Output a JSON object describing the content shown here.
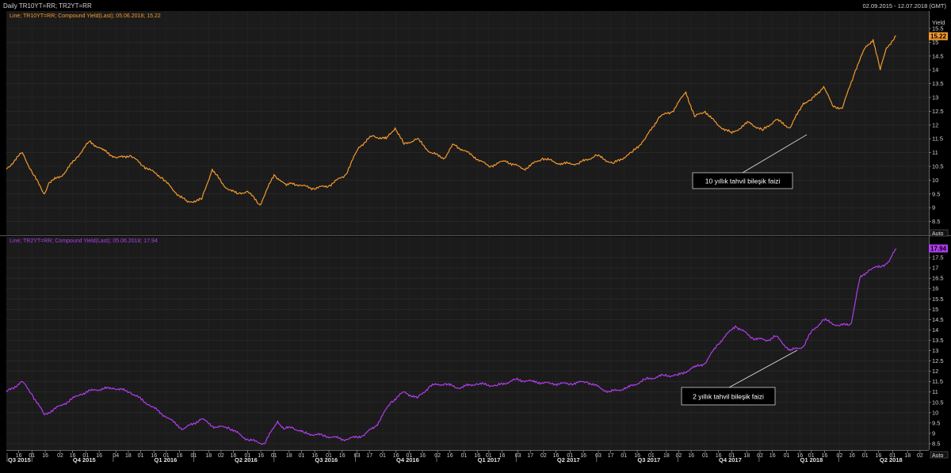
{
  "header": {
    "title": "Daily TR10YT=RR; TR2YT=RR",
    "date_range": "02.09.2015 - 12.07.2018 (GMT)"
  },
  "panels": {
    "top": {
      "legend": "Line; TR10YT=RR; Compound Yield(Last); 05.06.2018; 15.22",
      "axis_title": "Yield",
      "auto_label": "Auto",
      "last_value_label": "15.22",
      "annotation": "10 yıllık tahvil bileşik faizi"
    },
    "bottom": {
      "legend": "Line; TR2YT=RR; Compound Yield(Last); 05.06.2018; 17.94",
      "auto_label": "Auto",
      "last_value_label": "17.94",
      "annotation": "2 yıllık tahvil bileşik faizi"
    }
  },
  "colors": {
    "background": "#000000",
    "panel": "#1a1a1a",
    "grid": "#2c2c2c",
    "text": "#c8c8c8",
    "series_10y": "#f2992e",
    "series_2y": "#b23cf0"
  },
  "chart_data": [
    {
      "type": "line",
      "series": [
        {
          "name": "TR10YT=RR",
          "x": [
            "2015-09-02",
            "2015-09-20",
            "2015-10-01",
            "2015-10-15",
            "2015-10-20",
            "2015-11-05",
            "2015-11-20",
            "2015-12-05",
            "2015-12-20",
            "2016-01-05",
            "2016-01-20",
            "2016-02-05",
            "2016-02-25",
            "2016-03-10",
            "2016-03-25",
            "2016-04-10",
            "2016-04-22",
            "2016-05-05",
            "2016-05-20",
            "2016-06-01",
            "2016-06-15",
            "2016-07-01",
            "2016-07-08",
            "2016-07-15",
            "2016-07-21",
            "2016-08-01",
            "2016-08-15",
            "2016-09-01",
            "2016-09-20",
            "2016-10-05",
            "2016-10-20",
            "2016-11-05",
            "2016-11-15",
            "2016-11-25",
            "2016-12-10",
            "2016-12-25",
            "2017-01-10",
            "2017-01-20",
            "2017-02-10",
            "2017-03-01",
            "2017-03-20",
            "2017-04-10",
            "2017-05-01",
            "2017-05-20",
            "2017-06-10",
            "2017-07-01",
            "2017-07-20",
            "2017-08-10",
            "2017-08-25",
            "2017-09-10",
            "2017-09-25",
            "2017-10-10",
            "2017-10-20",
            "2017-11-01",
            "2017-11-15",
            "2017-12-01",
            "2017-12-20",
            "2018-01-05",
            "2018-01-20",
            "2018-02-05",
            "2018-02-20",
            "2018-03-01",
            "2018-03-15",
            "2018-03-25",
            "2018-04-05",
            "2018-04-20",
            "2018-05-01",
            "2018-05-10",
            "2018-05-18",
            "2018-05-25",
            "2018-06-05"
          ],
          "values": [
            10.4,
            11.0,
            10.3,
            9.5,
            9.9,
            10.2,
            10.8,
            11.4,
            11.1,
            10.8,
            10.9,
            10.5,
            10.1,
            9.6,
            9.2,
            9.3,
            10.4,
            9.8,
            9.5,
            9.6,
            9.1,
            10.2,
            10.0,
            9.8,
            9.9,
            9.8,
            9.7,
            9.8,
            10.2,
            11.2,
            11.6,
            11.5,
            11.9,
            11.3,
            11.5,
            11.0,
            10.8,
            11.3,
            10.9,
            10.5,
            10.7,
            10.4,
            10.8,
            10.6,
            10.6,
            10.9,
            10.6,
            11.0,
            11.5,
            12.3,
            12.5,
            13.2,
            12.3,
            12.5,
            12.0,
            11.7,
            12.1,
            11.8,
            12.2,
            11.9,
            12.8,
            12.9,
            13.4,
            12.7,
            12.6,
            14.0,
            14.8,
            15.1,
            14.0,
            14.8,
            15.22
          ]
        }
      ],
      "ylim": [
        8,
        15.5
      ],
      "ylabel": "Yield",
      "yticks": [
        8.5,
        9,
        9.5,
        10,
        10.5,
        11,
        11.5,
        12,
        12.5,
        13,
        13.5,
        14,
        14.5,
        15,
        15.5
      ],
      "title": "",
      "xlabel": "",
      "grid": true
    },
    {
      "type": "line",
      "series": [
        {
          "name": "TR2YT=RR",
          "x": [
            "2015-09-02",
            "2015-09-20",
            "2015-10-01",
            "2015-10-15",
            "2015-11-05",
            "2015-11-25",
            "2015-12-10",
            "2016-01-01",
            "2016-01-20",
            "2016-02-10",
            "2016-03-01",
            "2016-03-20",
            "2016-04-10",
            "2016-04-25",
            "2016-05-10",
            "2016-06-01",
            "2016-06-20",
            "2016-07-05",
            "2016-07-12",
            "2016-07-21",
            "2016-08-05",
            "2016-08-25",
            "2016-09-20",
            "2016-10-10",
            "2016-10-25",
            "2016-11-10",
            "2016-11-25",
            "2016-12-10",
            "2016-12-25",
            "2017-01-10",
            "2017-01-25",
            "2017-02-15",
            "2017-03-10",
            "2017-04-01",
            "2017-04-20",
            "2017-05-10",
            "2017-06-01",
            "2017-06-20",
            "2017-07-15",
            "2017-08-05",
            "2017-08-25",
            "2017-09-15",
            "2017-10-01",
            "2017-10-20",
            "2017-11-01",
            "2017-11-15",
            "2017-12-05",
            "2017-12-25",
            "2018-01-10",
            "2018-01-20",
            "2018-02-05",
            "2018-02-20",
            "2018-03-01",
            "2018-03-15",
            "2018-04-01",
            "2018-04-15",
            "2018-04-25",
            "2018-05-05",
            "2018-05-20",
            "2018-05-28",
            "2018-06-05"
          ],
          "values": [
            11.0,
            11.5,
            10.9,
            9.9,
            10.4,
            10.9,
            11.1,
            11.2,
            11.0,
            10.4,
            9.8,
            9.2,
            9.7,
            9.3,
            9.3,
            8.7,
            8.5,
            9.6,
            9.2,
            9.3,
            9.0,
            8.9,
            8.7,
            8.9,
            9.4,
            10.5,
            11.0,
            10.7,
            11.3,
            11.4,
            11.2,
            11.4,
            11.3,
            11.6,
            11.5,
            11.4,
            11.4,
            11.5,
            11.0,
            11.2,
            11.6,
            11.8,
            11.8,
            12.2,
            12.4,
            13.3,
            14.2,
            13.6,
            13.5,
            13.7,
            13.0,
            13.2,
            13.9,
            14.5,
            14.2,
            14.3,
            16.5,
            16.9,
            17.1,
            17.3,
            17.94
          ]
        }
      ],
      "ylim": [
        8.5,
        18
      ],
      "yticks": [
        8.5,
        9,
        9.5,
        10,
        10.5,
        11,
        11.5,
        12,
        12.5,
        13,
        13.5,
        14,
        14.5,
        15,
        15.5,
        16,
        16.5,
        17,
        17.5
      ],
      "title": "",
      "xlabel": "",
      "ylabel": "",
      "grid": true
    }
  ],
  "x_axis": {
    "start": "2015-09-02",
    "end": "2018-07-12",
    "day_ticks": [
      "2015-09-16",
      "2015-10-01",
      "2015-10-16",
      "2015-11-02",
      "2015-11-16",
      "2015-12-01",
      "2015-12-16",
      "2016-01-04",
      "2016-01-18",
      "2016-02-01",
      "2016-02-16",
      "2016-03-01",
      "2016-03-16",
      "2016-04-01",
      "2016-04-18",
      "2016-05-02",
      "2016-05-16",
      "2016-06-01",
      "2016-06-16",
      "2016-07-01",
      "2016-07-18",
      "2016-08-01",
      "2016-08-16",
      "2016-09-01",
      "2016-09-16",
      "2016-10-03",
      "2016-10-17",
      "2016-11-01",
      "2016-11-16",
      "2016-12-01",
      "2016-12-16",
      "2017-01-02",
      "2017-01-16",
      "2017-02-01",
      "2017-02-16",
      "2017-03-01",
      "2017-03-16",
      "2017-04-03",
      "2017-04-17",
      "2017-05-02",
      "2017-05-16",
      "2017-06-01",
      "2017-06-16",
      "2017-07-03",
      "2017-07-17",
      "2017-08-01",
      "2017-08-16",
      "2017-09-01",
      "2017-09-18",
      "2017-10-02",
      "2017-10-16",
      "2017-11-01",
      "2017-11-16",
      "2017-12-01",
      "2017-12-18",
      "2018-01-02",
      "2018-01-16",
      "2018-02-01",
      "2018-02-16",
      "2018-03-01",
      "2018-03-16",
      "2018-04-02",
      "2018-04-16",
      "2018-05-01",
      "2018-05-16",
      "2018-06-01",
      "2018-06-18",
      "2018-07-02"
    ],
    "quarters": [
      {
        "label": "Q3 2015",
        "date": "2015-09-02"
      },
      {
        "label": "Q4 2015",
        "date": "2015-10-01"
      },
      {
        "label": "Q1 2016",
        "date": "2016-01-01"
      },
      {
        "label": "Q2 2016",
        "date": "2016-04-01"
      },
      {
        "label": "Q3 2016",
        "date": "2016-07-01"
      },
      {
        "label": "Q4 2016",
        "date": "2016-10-01"
      },
      {
        "label": "Q1 2017",
        "date": "2017-01-01"
      },
      {
        "label": "Q2 2017",
        "date": "2017-04-01"
      },
      {
        "label": "Q3 2017",
        "date": "2017-07-01"
      },
      {
        "label": "Q4 2017",
        "date": "2017-10-01"
      },
      {
        "label": "Q1 2018",
        "date": "2018-01-01"
      },
      {
        "label": "Q2 2018",
        "date": "2018-04-01"
      }
    ]
  }
}
